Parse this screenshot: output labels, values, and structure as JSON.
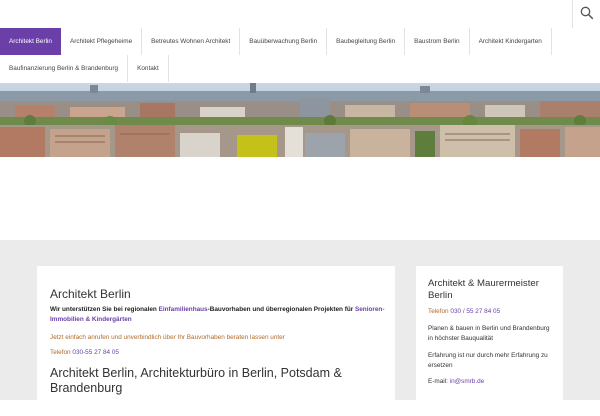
{
  "nav": {
    "row1": [
      {
        "label": "Architekt Berlin",
        "active": true
      },
      {
        "label": "Architekt Pflegeheime"
      },
      {
        "label": "Betreutes Wohnen Architekt"
      },
      {
        "label": "Bauüberwachung Berlin"
      },
      {
        "label": "Baubegleitung Berlin"
      },
      {
        "label": "Baustrom Berlin"
      },
      {
        "label": "Architekt Kindergarten"
      }
    ],
    "row2": [
      {
        "label": "Baufinanzierung Berlin & Brandenburg"
      },
      {
        "label": "Kontakt"
      }
    ]
  },
  "search": {
    "icon": "search-icon"
  },
  "hero": {
    "icon": "city-panorama-image"
  },
  "main": {
    "title": "Architekt Berlin",
    "intro_pre": "Wir unterstützen Sie bei regionalen ",
    "intro_link1": "Einfamilienhaus",
    "intro_mid": "-Bauvorhaben und überregionalen Projekten für ",
    "intro_link2": "Senioren-Immobilien & Kindergärten",
    "cta": "Jetzt einfach anrufen und unverbindlich über Ihr Bauvorhaben beraten lassen unter",
    "phone_label": "Telefon",
    "phone_number": "030-55 27 84 05",
    "heading": "Architekt Berlin, Architekturbüro in Berlin, Potsdam & Brandenburg"
  },
  "sidebar": {
    "title": "Architekt & Maurermeister Berlin",
    "phone_label": "Telefon",
    "phone_number": "030 / 55 27 84 05",
    "text1": "Planen & bauen in Berlin und Brandenburg in höchster Bauqualität",
    "text2": "Erfahrung ist nur durch mehr Erfahrung zu ersetzen",
    "email_label": "E-mail:",
    "email": "in@smrb.de"
  },
  "colors": {
    "accent": "#6a3fa8",
    "orange": "#b06a2c",
    "content_bg": "#ebebeb"
  }
}
